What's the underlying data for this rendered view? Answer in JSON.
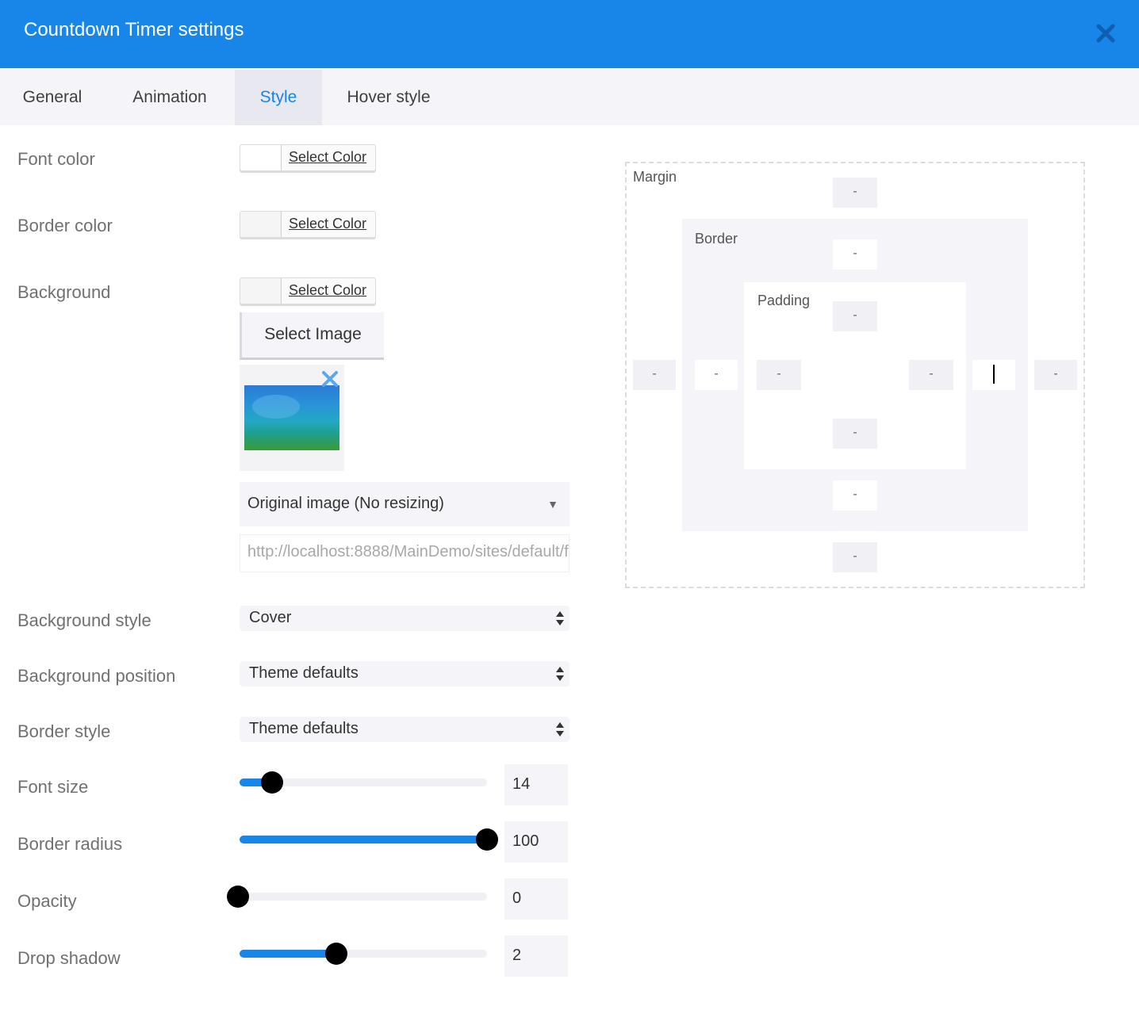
{
  "window": {
    "title": "Countdown Timer settings",
    "close_icon": "close-icon",
    "accent": "#1786e8"
  },
  "tabs": [
    {
      "label": "General",
      "active": false
    },
    {
      "label": "Animation",
      "active": false
    },
    {
      "label": "Style",
      "active": true
    },
    {
      "label": "Hover style",
      "active": false
    }
  ],
  "style": {
    "font_color": {
      "label": "Font color",
      "button": "Select Color",
      "value": "#ffffff"
    },
    "border_color": {
      "label": "Border color",
      "button": "Select Color",
      "value": "#f5f5f5"
    },
    "background": {
      "label": "Background",
      "button": "Select Color",
      "value": "#f5f5f5",
      "select_image_label": "Select Image",
      "resize_option": "Original image (No resizing)",
      "image_url": "http://localhost:8888/MainDemo/sites/default/files/"
    },
    "background_style": {
      "label": "Background style",
      "value": "Cover"
    },
    "background_position": {
      "label": "Background position",
      "value": "Theme defaults"
    },
    "border_style": {
      "label": "Border style",
      "value": "Theme defaults"
    },
    "font_size": {
      "label": "Font size",
      "value": "14",
      "fraction": 0.13
    },
    "border_radius": {
      "label": "Border radius",
      "value": "100",
      "fraction": 1.0
    },
    "opacity": {
      "label": "Opacity",
      "value": "0",
      "fraction": 0.0
    },
    "drop_shadow": {
      "label": "Drop shadow",
      "value": "2",
      "fraction": 0.39
    }
  },
  "box_model": {
    "margin_label": "Margin",
    "border_label": "Border",
    "padding_label": "Padding",
    "placeholder": "-"
  }
}
